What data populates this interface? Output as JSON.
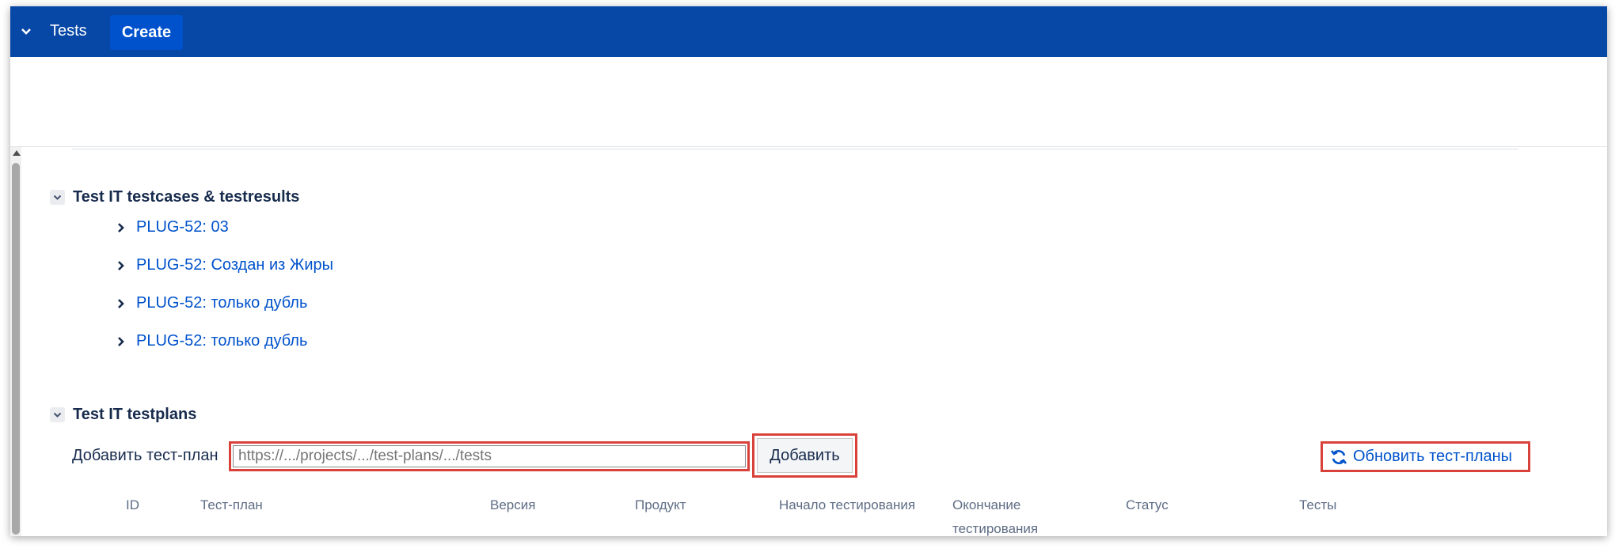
{
  "topbar": {
    "tab_label": "Tests",
    "create_label": "Create",
    "background": "#0747a6"
  },
  "sections": {
    "testcases": {
      "title": "Test IT testcases & testresults",
      "items": [
        {
          "label": "PLUG-52: 03"
        },
        {
          "label": "PLUG-52: Создан из Жиры"
        },
        {
          "label": "PLUG-52: только дубль"
        },
        {
          "label": "PLUG-52: только дубль"
        }
      ]
    },
    "testplans": {
      "title": "Test IT testplans",
      "add_label": "Добавить тест-план",
      "url_placeholder": "https://.../projects/.../test-plans/.../tests",
      "add_button": "Добавить",
      "refresh_button": "Обновить тест-планы",
      "columns": [
        "ID",
        "Тест-план",
        "Версия",
        "Продукт",
        "Начало тестирования",
        "Окончание тестирования",
        "Статус",
        "Тесты"
      ]
    }
  },
  "icons": {
    "topbar_toggle": "chevron-down-icon",
    "section_toggle": "chevron-down-icon",
    "item_expand": "chevron-right-icon",
    "refresh": "refresh-icon"
  },
  "colors": {
    "link": "#0052cc",
    "highlight": "#d9423a",
    "create": "#0052cc"
  }
}
